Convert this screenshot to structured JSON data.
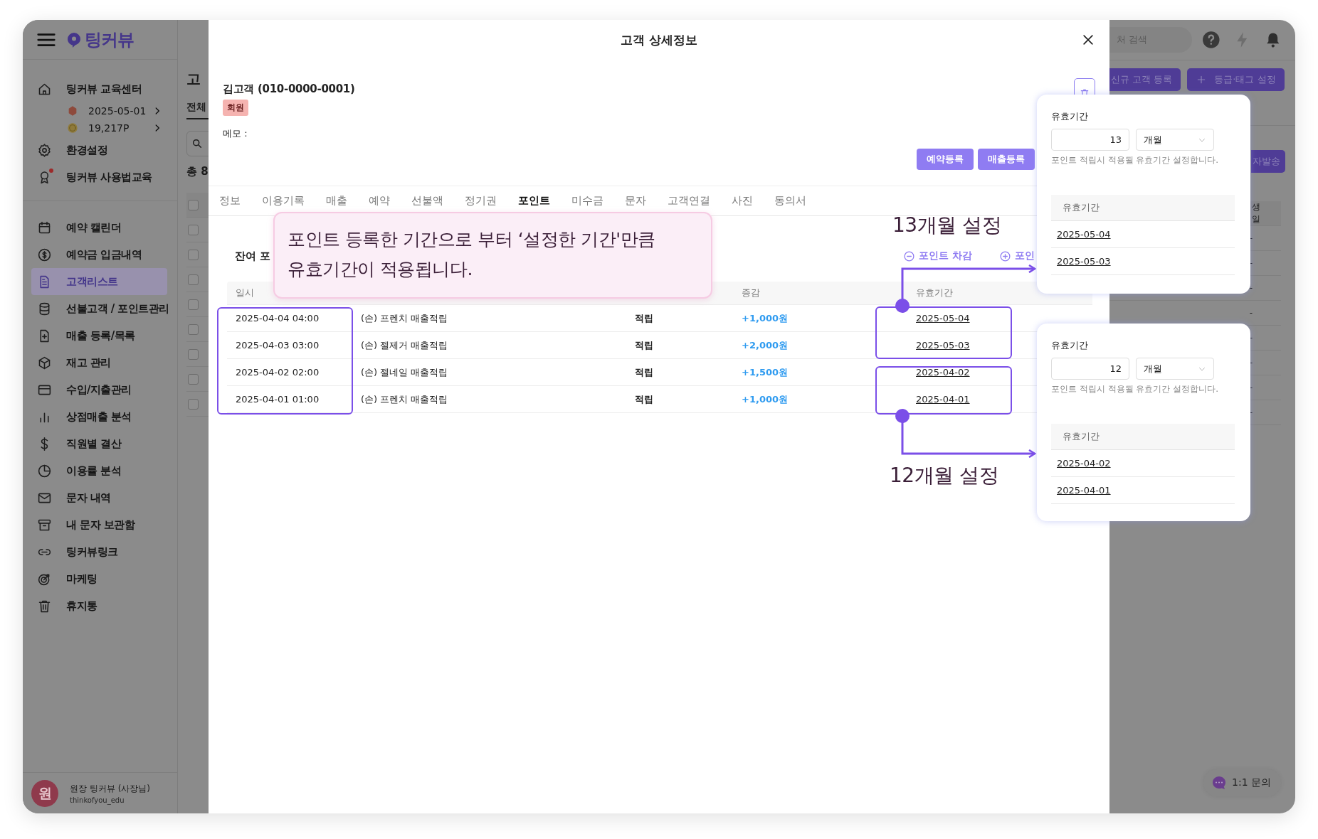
{
  "sidebar": {
    "logo": "팅커뷰",
    "center": {
      "name": "팅커뷰 교육센터",
      "date": "2025-05-01",
      "points": "19,217P"
    },
    "settings": [
      {
        "label": "환경설정",
        "alert": false
      },
      {
        "label": "팅커뷰 사용법교육",
        "alert": true
      }
    ],
    "items": [
      {
        "label": "예약 캘린더",
        "selected": false
      },
      {
        "label": "예약금 입금내역",
        "selected": false
      },
      {
        "label": "고객리스트",
        "selected": true
      },
      {
        "label": "선불고객 / 포인트관리",
        "selected": false
      },
      {
        "label": "매출 등록/목록",
        "selected": false
      },
      {
        "label": "재고 관리",
        "selected": false
      },
      {
        "label": "수입/지출관리",
        "selected": false
      },
      {
        "label": "상점매출 분석",
        "selected": false
      },
      {
        "label": "직원별 결산",
        "selected": false
      },
      {
        "label": "이용률 분석",
        "selected": false
      },
      {
        "label": "문자 내역",
        "selected": false
      },
      {
        "label": "내 문자 보관함",
        "selected": false
      },
      {
        "label": "팅커뷰링크",
        "selected": false
      },
      {
        "label": "마케팅",
        "selected": false
      },
      {
        "label": "휴지통",
        "selected": false
      }
    ],
    "user": {
      "avatar": "원",
      "name": "원장 팅커뷰 (사장님)",
      "id": "thinkofyou_edu"
    }
  },
  "page": {
    "title": "고",
    "tab": "전체",
    "count": "총 8",
    "search": {
      "placeholder": "처 검색"
    },
    "buttons": [
      "신규 고객 등록",
      "등급·태그 설정"
    ],
    "send_button": "자발송",
    "column": "생일",
    "all_checked": false,
    "rows": [
      {
        "checked": false,
        "birthday": "-"
      },
      {
        "checked": false,
        "birthday": "-"
      },
      {
        "checked": false,
        "birthday": "-"
      },
      {
        "checked": false,
        "birthday": "-"
      },
      {
        "checked": false,
        "birthday": "-"
      },
      {
        "checked": false,
        "birthday": "-"
      },
      {
        "checked": false,
        "birthday": "-"
      },
      {
        "checked": false,
        "birthday": "-"
      }
    ],
    "inquiry": "1:1 문의"
  },
  "modal": {
    "title": "고객 상세정보",
    "customer": "김고객 (010-0000-0001)",
    "tag": "회원",
    "memo": "메모 :",
    "actions": [
      "예약등록",
      "매출등록"
    ],
    "tabs": [
      {
        "label": "정보",
        "selected": false
      },
      {
        "label": "이용기록",
        "selected": false
      },
      {
        "label": "매출",
        "selected": false
      },
      {
        "label": "예약",
        "selected": false
      },
      {
        "label": "선불액",
        "selected": false
      },
      {
        "label": "정기권",
        "selected": false
      },
      {
        "label": "포인트",
        "selected": true
      },
      {
        "label": "미수금",
        "selected": false
      },
      {
        "label": "문자",
        "selected": false
      },
      {
        "label": "고객연결",
        "selected": false
      },
      {
        "label": "사진",
        "selected": false
      },
      {
        "label": "동의서",
        "selected": false
      }
    ],
    "balance": "잔여 포",
    "point_buttons": [
      "포인트 차감",
      "포인"
    ],
    "columns": {
      "date": "일시",
      "amount": "증감",
      "expiry": "유효기간"
    },
    "rows": [
      {
        "date": "2025-04-04 04:00",
        "description": "(손) 프렌치 매출적립",
        "type": "적립",
        "amount": "+1,000원",
        "expiry": "2025-05-04"
      },
      {
        "date": "2025-04-03 03:00",
        "description": "(손) 젤제거 매출적립",
        "type": "적립",
        "amount": "+2,000원",
        "expiry": "2025-05-03"
      },
      {
        "date": "2025-04-02 02:00",
        "description": "(손) 젤네일 매출적립",
        "type": "적립",
        "amount": "+1,500원",
        "expiry": "2025-04-02"
      },
      {
        "date": "2025-04-01 01:00",
        "description": "(손) 프렌치 매출적립",
        "type": "적립",
        "amount": "+1,000원",
        "expiry": "2025-04-01"
      }
    ]
  },
  "popups": [
    {
      "label": "유효기간",
      "value": "13",
      "unit": "개월",
      "hint": "포인트 적립시 적용될 유효기간 설정합니다.",
      "column": "유효기간",
      "dates": [
        "2025-05-04",
        "2025-05-03"
      ]
    },
    {
      "label": "유효기간",
      "value": "12",
      "unit": "개월",
      "hint": "포인트 적립시 적용될 유효기간 설정합니다.",
      "column": "유효기간",
      "dates": [
        "2025-04-02",
        "2025-04-01"
      ]
    }
  ],
  "annotations": {
    "callout": "포인트 등록한 기간으로 부터 ‘설정한 기간'만큼\n유효기간이 적용됩니다.",
    "labels": [
      "13개월 설정",
      "12개월 설정"
    ]
  }
}
